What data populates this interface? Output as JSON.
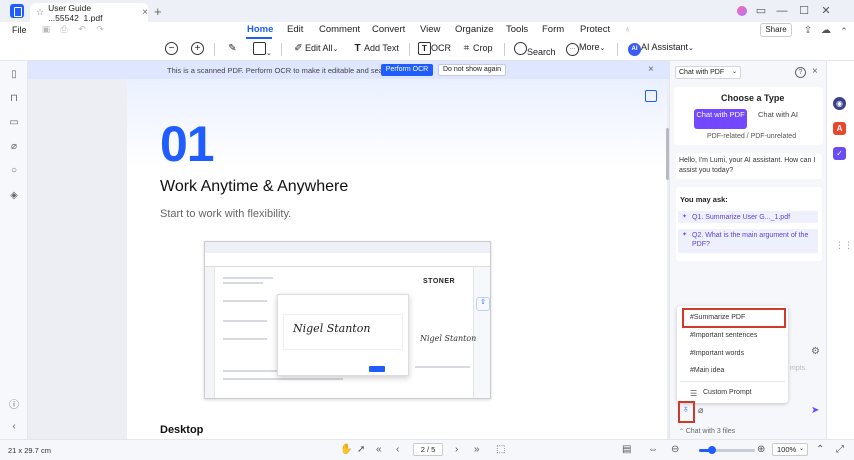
{
  "window": {
    "tab_title": "User Guide ...55542_1.pdf",
    "tab_star": "☆",
    "tab_close": "×",
    "tab_add": "+",
    "minimize": "—",
    "maximize": "☐",
    "close": "✕"
  },
  "menu": {
    "file": "File",
    "tabs": [
      "Home",
      "Edit",
      "Comment",
      "Convert",
      "View",
      "Organize",
      "Tools",
      "Form",
      "Protect"
    ],
    "share": "Share"
  },
  "toolbar": {
    "edit_all": "Edit All",
    "add_text": "Add Text",
    "ocr": "OCR",
    "crop": "Crop",
    "search": "Search",
    "more": "More",
    "ai_assistant": "AI Assistant",
    "ai_badge": "AI"
  },
  "ocr_banner": {
    "message": "This is a scanned PDF. Perform OCR to make it editable and searchable.",
    "action": "Perform OCR",
    "dismiss": "Do not show again",
    "close": "×"
  },
  "document": {
    "big_number": "01",
    "heading": "Work Anytime & Anywhere",
    "subheading": "Start to work with flexibility.",
    "section_label": "Desktop",
    "embed": {
      "brand": "STONER",
      "signature": "Nigel Stanton",
      "signature_small": "Nigel Stanton"
    }
  },
  "ai_panel": {
    "mode": "Chat with PDF",
    "help": "?",
    "close": "×",
    "choose_title": "Choose a Type",
    "chat_pdf": "Chat with PDF",
    "chat_ai": "Chat with AI",
    "type_desc": "PDF-related / PDF-unrelated",
    "greeting": "Hello, I'm Lumi, your AI assistant. How can I assist you today?",
    "you_may_ask": "You may ask:",
    "q1": "Q1. Summarize User G..._1.pdf",
    "q2": "Q2. What is the main argument of the PDF?",
    "prompts": [
      "#Summarize PDF",
      "#Important sentences",
      "#Important words",
      "#Main idea"
    ],
    "custom_prompt": "Custom Prompt",
    "input_hint": "mpts.",
    "chat_files": "Chat with 3 files"
  },
  "statusbar": {
    "page_size": "21 x 29.7 cm",
    "page_input": "2 / 5",
    "zoom": "100%"
  },
  "colors": {
    "accent": "#1f5dff",
    "ai_purple": "#7448ff",
    "highlight_red": "#d13a2a"
  }
}
